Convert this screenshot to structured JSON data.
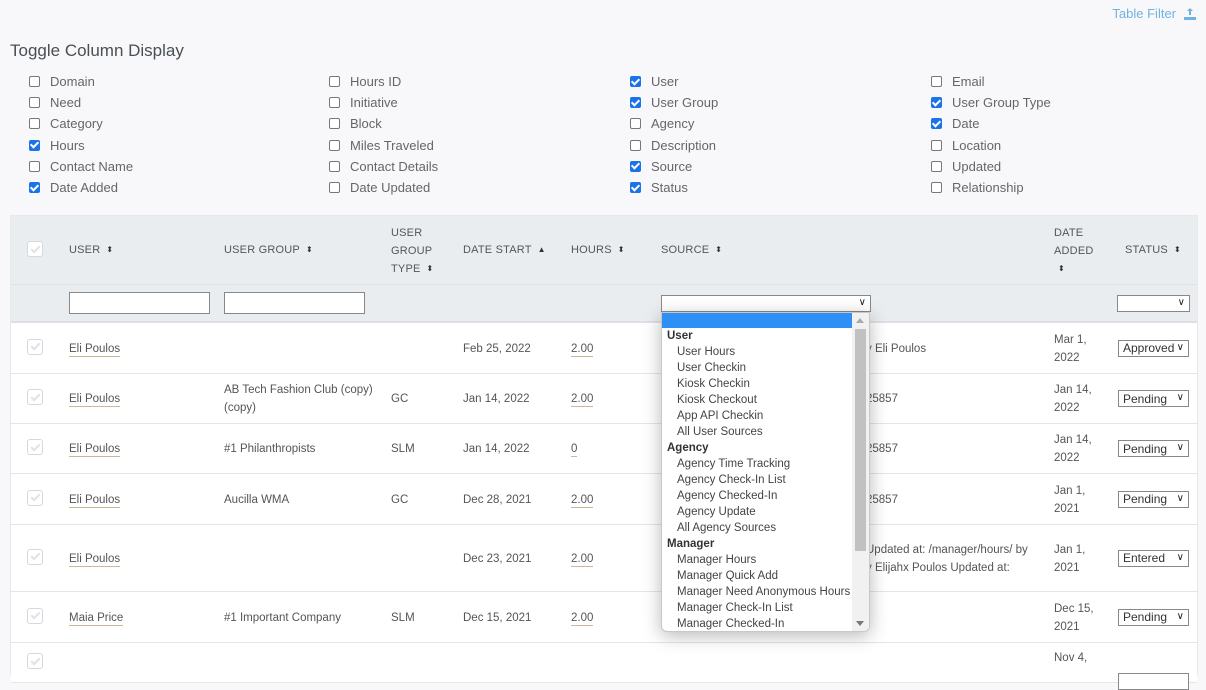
{
  "header": {
    "table_filter_label": "Table Filter",
    "table_filter_icon": "upload-icon",
    "toggle_title": "Toggle Column Display"
  },
  "toggles": [
    [
      {
        "label": "Domain",
        "checked": false
      },
      {
        "label": "Need",
        "checked": false
      },
      {
        "label": "Category",
        "checked": false
      },
      {
        "label": "Hours",
        "checked": true
      },
      {
        "label": "Contact Name",
        "checked": false
      },
      {
        "label": "Date Added",
        "checked": true
      }
    ],
    [
      {
        "label": "Hours ID",
        "checked": false
      },
      {
        "label": "Initiative",
        "checked": false
      },
      {
        "label": "Block",
        "checked": false
      },
      {
        "label": "Miles Traveled",
        "checked": false
      },
      {
        "label": "Contact Details",
        "checked": false
      },
      {
        "label": "Date Updated",
        "checked": false
      }
    ],
    [
      {
        "label": "User",
        "checked": true
      },
      {
        "label": "User Group",
        "checked": true
      },
      {
        "label": "Agency",
        "checked": false
      },
      {
        "label": "Description",
        "checked": false
      },
      {
        "label": "Source",
        "checked": true
      },
      {
        "label": "Status",
        "checked": true
      }
    ],
    [
      {
        "label": "Email",
        "checked": false
      },
      {
        "label": "User Group Type",
        "checked": true
      },
      {
        "label": "Date",
        "checked": true
      },
      {
        "label": "Location",
        "checked": false
      },
      {
        "label": "Updated",
        "checked": false
      },
      {
        "label": "Relationship",
        "checked": false
      }
    ]
  ],
  "table": {
    "columns": {
      "user": "USER",
      "user_group": "USER GROUP",
      "user_group_type_1": "USER",
      "user_group_type_2": "GROUP",
      "user_group_type_3": "TYPE",
      "date_start": "DATE START",
      "hours": "HOURS",
      "source": "SOURCE",
      "date_added_1": "DATE",
      "date_added_2": "ADDED",
      "status": "STATUS"
    },
    "sort_icons": {
      "default": "⬍",
      "asc": "▲"
    },
    "filters": {
      "user": "",
      "user_group": "",
      "source": "",
      "status": ""
    },
    "rows": [
      {
        "user": "Eli Poulos",
        "group": "",
        "group_line2": "",
        "type": "",
        "date": "Feb 25, 2022",
        "hours": "2.00",
        "source1": "y Eli Poulos",
        "source2": "",
        "added1": "Mar 1,",
        "added2": "2022",
        "status": "Approved"
      },
      {
        "user": "Eli Poulos",
        "group": "AB Tech Fashion Club (copy)",
        "group_line2": "(copy)",
        "type": "GC",
        "date": "Jan 14, 2022",
        "hours": "2.00",
        "source1": "25857",
        "source2": "",
        "added1": "Jan 14,",
        "added2": "2022",
        "status": "Pending"
      },
      {
        "user": "Eli Poulos",
        "group": "#1 Philanthropists",
        "group_line2": "",
        "type": "SLM",
        "date": "Jan 14, 2022",
        "hours": "0",
        "source1": "25857",
        "source2": "",
        "added1": "Jan 14,",
        "added2": "2022",
        "status": "Pending"
      },
      {
        "user": "Eli Poulos",
        "group": "Aucilla WMA",
        "group_line2": "",
        "type": "GC",
        "date": "Dec 28, 2021",
        "hours": "2.00",
        "source1": "25857",
        "source2": "",
        "added1": "Jan 1,",
        "added2": "2021",
        "status": "Pending"
      },
      {
        "user": "Eli Poulos",
        "group": "",
        "group_line2": "",
        "type": "",
        "date": "Dec 23, 2021",
        "hours": "2.00",
        "source1": "Updated at: /manager/hours/ by",
        "source2": "y Elijahx Poulos Updated at:",
        "added1": "Jan 1,",
        "added2": "2021",
        "status": "Entered"
      },
      {
        "user": "Maia Price",
        "group": "#1 Important Company",
        "group_line2": "",
        "type": "SLM",
        "date": "Dec 15, 2021",
        "hours": "2.00",
        "source1": "",
        "source2": "",
        "added1": "Dec 15,",
        "added2": "2021",
        "status": "Pending"
      },
      {
        "user": "",
        "group": "",
        "group_line2": "",
        "type": "",
        "date": "",
        "hours": "",
        "source1": "",
        "source2": "",
        "added1": "Nov 4,",
        "added2": "",
        "status": ""
      }
    ]
  },
  "source_dropdown": {
    "selected": "",
    "groups": [
      {
        "label": "User",
        "options": [
          "User Hours",
          "User Checkin",
          "Kiosk Checkin",
          "Kiosk Checkout",
          "App API Checkin",
          "All User Sources"
        ]
      },
      {
        "label": "Agency",
        "options": [
          "Agency Time Tracking",
          "Agency Check-In List",
          "Agency Checked-In",
          "Agency Update",
          "All Agency Sources"
        ]
      },
      {
        "label": "Manager",
        "options": [
          "Manager Hours",
          "Manager Quick Add",
          "Manager Need Anonymous Hours",
          "Manager Check-In List",
          "Manager Checked-In"
        ]
      }
    ]
  },
  "colors": {
    "accent": "#1a73e8",
    "link": "#6fb3e0",
    "highlight": "#2e8ff7"
  }
}
